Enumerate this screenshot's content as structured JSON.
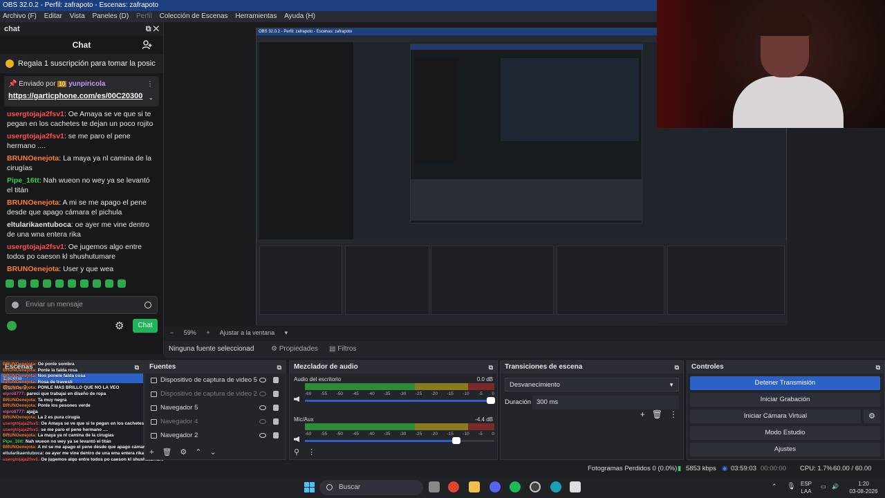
{
  "window": {
    "title": "OBS 32.0.2 - Perfil: zafrapoto - Escenas: zafrapoto"
  },
  "menu": [
    "Archivo (F)",
    "Editar",
    "Vista",
    "Paneles (D)",
    "Perfil",
    "Colección de Escenas",
    "Herramientas",
    "Ayuda (H)"
  ],
  "chat_dock": {
    "title": "chat",
    "header": "Chat",
    "gift_banner": "Regala 1 suscripción para tomar la posic",
    "pinned": {
      "by": "Enviado por",
      "badge": "10",
      "sender": "yunpiricola",
      "link": "https://garticphone.com/es/00C20300"
    },
    "messages": [
      {
        "user": "usergtojaja2fsv1",
        "cls": "u1",
        "text": "Oe Amaya se ve que si te pegan en los cachetes te dejan un poco rojito"
      },
      {
        "user": "usergtojaja2fsv1",
        "cls": "u1",
        "text": "se me paro el pene hermano ...."
      },
      {
        "user": "BRUNOenejota",
        "cls": "u2",
        "text": "La maya ya nl camina de la cirugías"
      },
      {
        "user": "Pipe_16tt",
        "cls": "u3",
        "text": "Nah wueon no wey ya se levantó el titán"
      },
      {
        "user": "BRUNOenejota",
        "cls": "u2",
        "text": "A mi se me apago el pene desde que apago cámara el pichula"
      },
      {
        "user": "eltularikaentuboca",
        "cls": "u4",
        "text": "oe ayer me vine dentro de una wna entera rika"
      },
      {
        "user": "usergtojaja2fsv1",
        "cls": "u1",
        "text": "Oe jugemos algo entre todos po caeson kl shushutumare"
      },
      {
        "user": "BRUNOenejota",
        "cls": "u2",
        "text": "User y que wea"
      }
    ],
    "input_placeholder": "Enviar un mensaje",
    "send_label": "Chat"
  },
  "preview": {
    "zoom": "59%",
    "fit_label": "Ajustar a la ventana"
  },
  "source_bar": {
    "selected": "Ninguna fuente seleccionad",
    "properties": "Propiedades",
    "filters": "Filtros"
  },
  "docks": {
    "scenes": {
      "title": "Escenas",
      "items": [
        "Escena",
        "Escena 2"
      ]
    },
    "sources": {
      "title": "Fuentes",
      "items": [
        {
          "name": "Dispositivo de captura de video 5",
          "visible": true
        },
        {
          "name": "Dispositivo de captura de video 2",
          "visible": false
        },
        {
          "name": "Navegador 5",
          "visible": true
        },
        {
          "name": "Navegador 4",
          "visible": false
        },
        {
          "name": "Navegador 2",
          "visible": true
        }
      ]
    },
    "mixer": {
      "title": "Mezclador de audio",
      "channels": [
        {
          "name": "Audio del escritorio",
          "db": "0.0 dB",
          "volume": 0.98
        },
        {
          "name": "Mic/Aux",
          "db": "-4.4 dB",
          "volume": 0.8
        }
      ],
      "ticks": [
        "-60",
        "-55",
        "-50",
        "-45",
        "-40",
        "-35",
        "-30",
        "-25",
        "-20",
        "-15",
        "-10",
        "-5",
        "0"
      ]
    },
    "transitions": {
      "title": "Transiciones de escena",
      "selected": "Desvanecimiento",
      "duration_label": "Duración",
      "duration": "300 ms"
    },
    "controls": {
      "title": "Controles",
      "buttons": [
        "Detener Transmisión",
        "Iniciar Grabación",
        "Iniciar Cámara Virtual",
        "Modo Estudio",
        "Ajustes"
      ]
    }
  },
  "status": {
    "dropped": "Fotogramas Perdidos 0 (0.0%)",
    "bitrate": "5853 kbps",
    "live": "03:59:03",
    "rec": "00:00:00",
    "cpu": "CPU: 1.7%",
    "fps": "60.00 / 60.00 FPS"
  },
  "taskbar": {
    "search": "Buscar",
    "lang": "ESP",
    "layout": "LAA",
    "time": "1:20",
    "date": "03-08-2026"
  },
  "overlay_chat": [
    "BRUNOenejota: Oe ponle sombra",
    "BRUNOenejota: Ponle la falda rosa",
    "BRUNOenejota: Noo ponele falda cosa",
    "BRUNOenejota: Rosa de travesti",
    "BRUNOenejota: PONLE MAS BRILLO QUE NO LA VEO",
    "elpro8777: pareci que trabajai en diseño de ropa",
    "BRUNOenejota: Ta muy negra",
    "BRUNOenejota: Ponle los pesones verde",
    "elpro8777: ajajja",
    "BRUNOenejota: La 2 es pura cirugía",
    "usergtojaja2fsv1: Oe Amaya se ve que si te pegan en los cachetes te dejan un poco rojito",
    "usergtojaja2fsv1: se me paro el pene hermano ....",
    "BRUNOenejota: La maya ya nl camina de la cirugías",
    "Pipe_16tt: Nah wueon no wey ya se levantó el titán",
    "BRUNOenejota: A mi se me apago el pene desde que apago cámara el pichula",
    "eltularikaentuboca: oe ayer me vine dentro de una wna entera rika",
    "usergtojaja2fsv1: Oe jugemos algo entre todos po caeson kl shushutumare",
    "BRUNOenejota: User y que wea"
  ],
  "colors": {
    "accent": "#2c62c7",
    "chat_green": "#1fb35a"
  }
}
